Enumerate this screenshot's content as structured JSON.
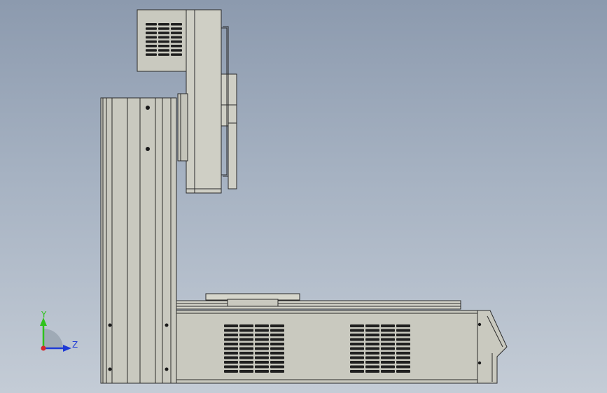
{
  "window": {
    "view": "cad-3d-viewport"
  },
  "model": {
    "name": "",
    "color_body": "#c9c9bf",
    "color_edge": "#2a2a2a",
    "color_slot": "#1f1f1f"
  },
  "triad": {
    "x_axis": {
      "label": "",
      "color": "#d6262b"
    },
    "y_axis": {
      "label": "Y",
      "color": "#2fc21c"
    },
    "z_axis": {
      "label": "Z",
      "color": "#1f3bd6"
    }
  },
  "background": {
    "top": "#8c9aae",
    "bottom": "#c4ccd6"
  }
}
